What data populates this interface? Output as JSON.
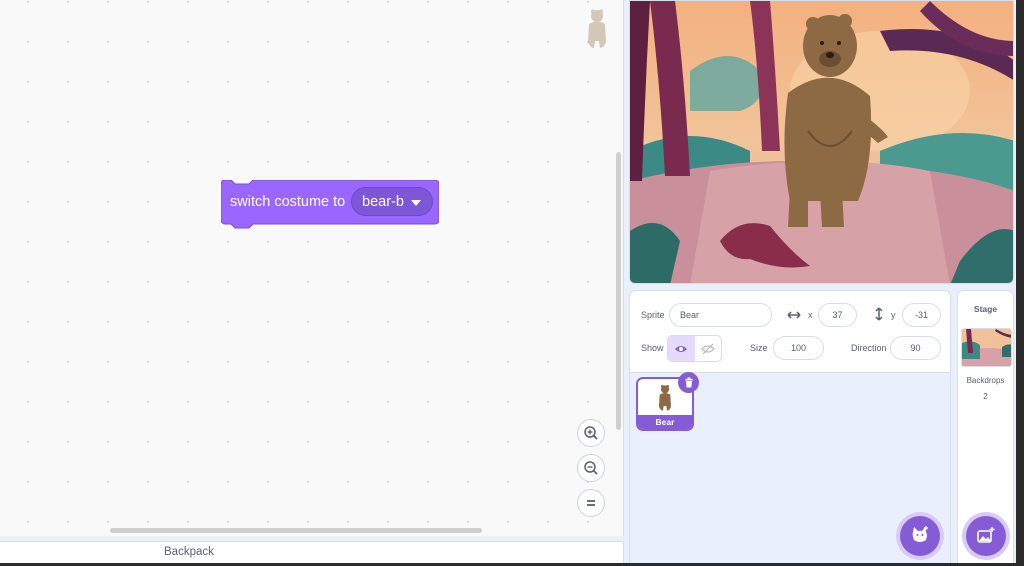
{
  "workspace": {
    "block": {
      "text": "switch costume to",
      "costume": "bear-b",
      "color": "#9966ff"
    },
    "zoom": {
      "in_icon": "zoom-in-icon",
      "out_icon": "zoom-out-icon",
      "reset_icon": "zoom-reset-icon"
    }
  },
  "backpack": {
    "label": "Backpack"
  },
  "sprite_info": {
    "sprite_label": "Sprite",
    "sprite_name": "Bear",
    "x_label": "x",
    "x_value": "37",
    "y_label": "y",
    "y_value": "-31",
    "show_label": "Show",
    "size_label": "Size",
    "size_value": "100",
    "direction_label": "Direction",
    "direction_value": "90"
  },
  "sprites": [
    {
      "name": "Bear",
      "selected": true
    }
  ],
  "stage_pane": {
    "title": "Stage",
    "backdrops_label": "Backdrops",
    "backdrops_count": "2"
  },
  "colors": {
    "accent": "#855cd6",
    "looks_block": "#9966ff"
  }
}
